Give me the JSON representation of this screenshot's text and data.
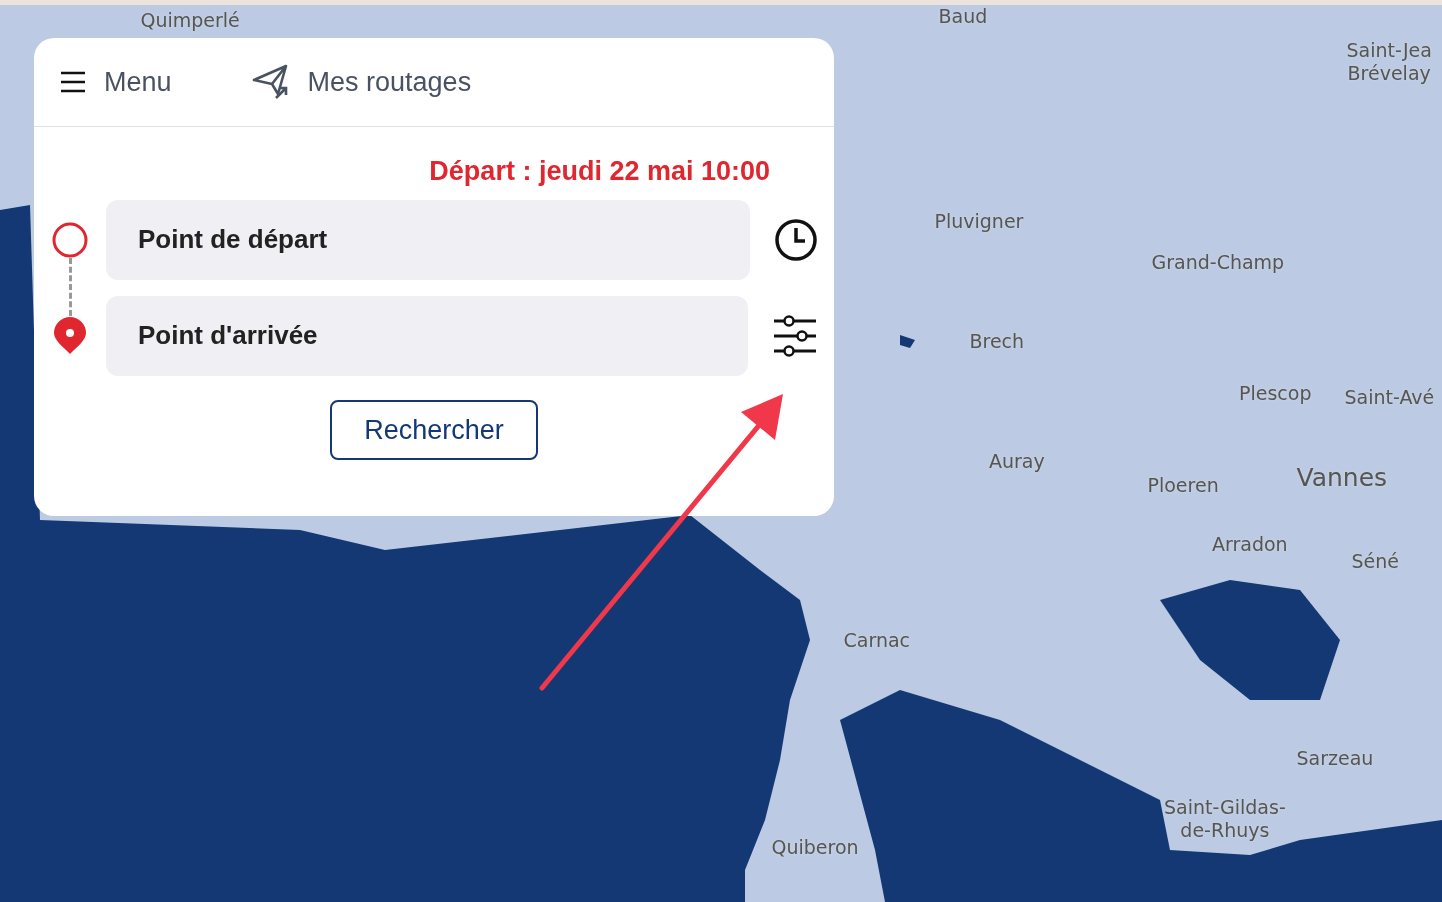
{
  "map": {
    "labels": [
      {
        "text": "Quimperlé",
        "kind": "town"
      },
      {
        "text": "Baud",
        "kind": "town"
      },
      {
        "text": "Saint-Jea\nBrévelay",
        "kind": "town"
      },
      {
        "text": "Pluvigner",
        "kind": "town"
      },
      {
        "text": "Grand-Champ",
        "kind": "town"
      },
      {
        "text": "Brech",
        "kind": "town"
      },
      {
        "text": "Plescop",
        "kind": "town"
      },
      {
        "text": "Saint-Avé",
        "kind": "town"
      },
      {
        "text": "Auray",
        "kind": "town"
      },
      {
        "text": "Ploeren",
        "kind": "town"
      },
      {
        "text": "Vannes",
        "kind": "city"
      },
      {
        "text": "Arradon",
        "kind": "town"
      },
      {
        "text": "Séné",
        "kind": "town"
      },
      {
        "text": "Carnac",
        "kind": "town"
      },
      {
        "text": "Sarzeau",
        "kind": "town"
      },
      {
        "text": "Saint-Gildas-\nde-Rhuys",
        "kind": "town"
      },
      {
        "text": "Quiberon",
        "kind": "town"
      }
    ]
  },
  "panel": {
    "nav": [
      {
        "label": "Menu"
      },
      {
        "label": "Mes routages"
      }
    ],
    "departure": "Départ : jeudi 22 mai 10:00",
    "fields": [
      {
        "placeholder": "Point de départ"
      },
      {
        "placeholder": "Point d'arrivée"
      }
    ],
    "button": "Rechercher"
  }
}
